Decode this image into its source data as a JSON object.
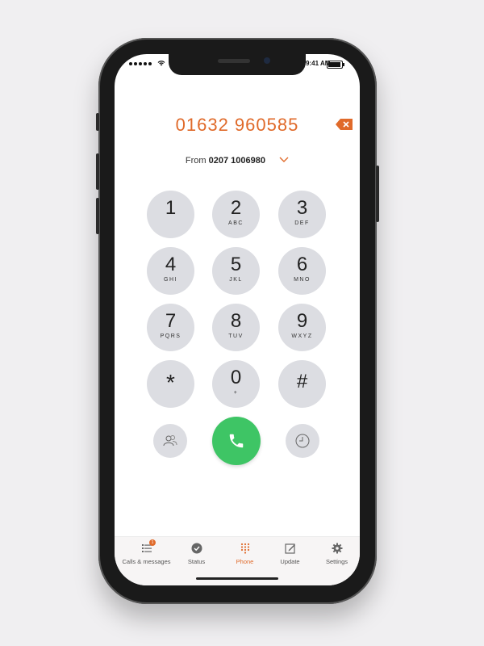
{
  "status_bar": {
    "time": "9:41 AM",
    "battery_level": 0.85
  },
  "dialer": {
    "number": "01632 960585",
    "from_label": "From",
    "from_number": "0207 1006980"
  },
  "keypad": [
    {
      "digit": "1",
      "letters": ""
    },
    {
      "digit": "2",
      "letters": "ABC"
    },
    {
      "digit": "3",
      "letters": "DEF"
    },
    {
      "digit": "4",
      "letters": "GHI"
    },
    {
      "digit": "5",
      "letters": "JKL"
    },
    {
      "digit": "6",
      "letters": "MNO"
    },
    {
      "digit": "7",
      "letters": "PQRS"
    },
    {
      "digit": "8",
      "letters": "TUV"
    },
    {
      "digit": "9",
      "letters": "WXYZ"
    },
    {
      "digit": "*",
      "letters": ""
    },
    {
      "digit": "0",
      "letters": "+"
    },
    {
      "digit": "#",
      "letters": ""
    }
  ],
  "tabs": [
    {
      "label": "Calls & messages",
      "icon": "list-icon",
      "badge": "1"
    },
    {
      "label": "Status",
      "icon": "check-circle-icon"
    },
    {
      "label": "Phone",
      "icon": "keypad-icon",
      "active": true
    },
    {
      "label": "Update",
      "icon": "edit-icon"
    },
    {
      "label": "Settings",
      "icon": "gear-icon"
    }
  ],
  "colors": {
    "accent": "#e06a2a",
    "call_green": "#3ec565",
    "key_bg": "#dcdde2"
  }
}
